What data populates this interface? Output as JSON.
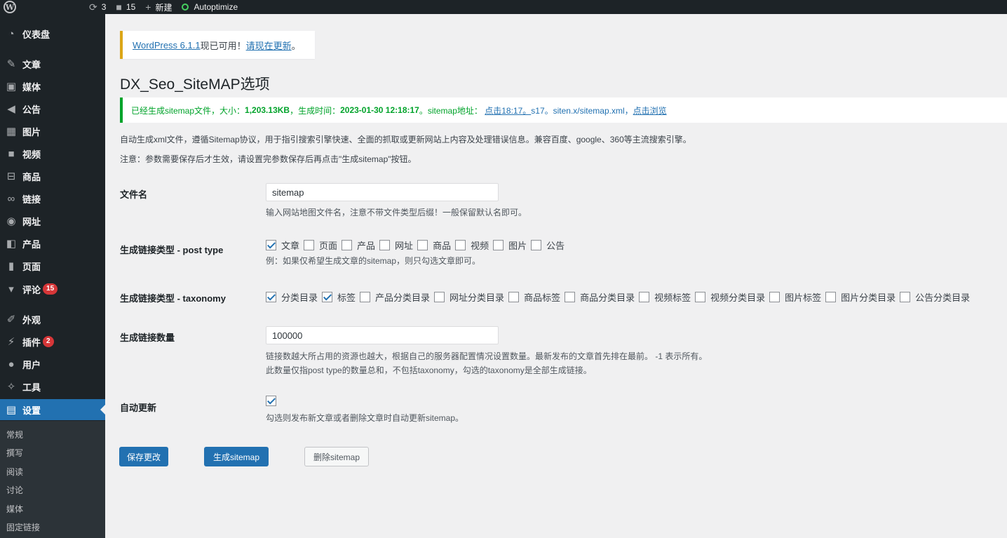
{
  "adminbar": {
    "logo": "W",
    "updates_count": "3",
    "comments_count": "15",
    "new_label": "新建",
    "plugin_label": "Autoptimize"
  },
  "sidebar": {
    "items": [
      {
        "icon": "dashboard-icon",
        "label": "仪表盘"
      },
      {
        "icon": "pin-icon",
        "label": "文章"
      },
      {
        "icon": "media-icon",
        "label": "媒体"
      },
      {
        "icon": "megaphone-icon",
        "label": "公告"
      },
      {
        "icon": "image-icon",
        "label": "图片"
      },
      {
        "icon": "video-icon",
        "label": "视频"
      },
      {
        "icon": "cart-icon",
        "label": "商品"
      },
      {
        "icon": "link-icon",
        "label": "链接"
      },
      {
        "icon": "globe-icon",
        "label": "网址"
      },
      {
        "icon": "product-icon",
        "label": "产品"
      },
      {
        "icon": "page-icon",
        "label": "页面"
      },
      {
        "icon": "comment-icon",
        "label": "评论",
        "badge": "15"
      },
      {
        "icon": "brush-icon",
        "label": "外观"
      },
      {
        "icon": "plugin-icon",
        "label": "插件",
        "badge": "2"
      },
      {
        "icon": "user-icon",
        "label": "用户"
      },
      {
        "icon": "wrench-icon",
        "label": "工具"
      },
      {
        "icon": "settings-icon",
        "label": "设置"
      }
    ],
    "submenu": [
      "常规",
      "撰写",
      "阅读",
      "讨论",
      "媒体",
      "固定链接"
    ]
  },
  "notice_update": {
    "link1": "WordPress 6.1.1",
    "text": "现已可用！",
    "link2": "请现在更新",
    "end": "。"
  },
  "page_title": "DX_Seo_SiteMAP选项",
  "notice_success": {
    "prefix": "已经生成sitemap文件，大小：",
    "size": "1,203.13KB",
    "time_label": "，生成时间：",
    "time": "2023-01-30 12:18:17",
    "addr_label": "。sitemap地址：",
    "link_click": "点击18:17。",
    "link_url": "s17。siten.x/sitemap.xml",
    "sep": "，",
    "link_browse": "点击浏览"
  },
  "description": [
    "自动生成xml文件，遵循Sitemap协议，用于指引搜索引擎快速、全面的抓取或更新网站上内容及处理错误信息。兼容百度、google、360等主流搜索引擎。",
    "注意：参数需要保存后才生效，请设置完参数保存后再点击\"生成sitemap\"按钮。"
  ],
  "fields": {
    "filename": {
      "label": "文件名",
      "value": "sitemap",
      "help": "输入网站地图文件名，注意不带文件类型后缀！一般保留默认名即可。"
    },
    "post_type": {
      "label": "生成链接类型 - post type",
      "options": [
        {
          "label": "文章",
          "checked": true
        },
        {
          "label": "页面",
          "checked": false
        },
        {
          "label": "产品",
          "checked": false
        },
        {
          "label": "网址",
          "checked": false
        },
        {
          "label": "商品",
          "checked": false
        },
        {
          "label": "视频",
          "checked": false
        },
        {
          "label": "图片",
          "checked": false
        },
        {
          "label": "公告",
          "checked": false
        }
      ],
      "help": "例：如果仅希望生成文章的sitemap，则只勾选文章即可。"
    },
    "taxonomy": {
      "label": "生成链接类型 - taxonomy",
      "options": [
        {
          "label": "分类目录",
          "checked": true
        },
        {
          "label": "标签",
          "checked": true
        },
        {
          "label": "产品分类目录",
          "checked": false
        },
        {
          "label": "网址分类目录",
          "checked": false
        },
        {
          "label": "商品标签",
          "checked": false
        },
        {
          "label": "商品分类目录",
          "checked": false
        },
        {
          "label": "视频标签",
          "checked": false
        },
        {
          "label": "视频分类目录",
          "checked": false
        },
        {
          "label": "图片标签",
          "checked": false
        },
        {
          "label": "图片分类目录",
          "checked": false
        },
        {
          "label": "公告分类目录",
          "checked": false
        }
      ]
    },
    "count": {
      "label": "生成链接数量",
      "value": "100000",
      "help1": "链接数越大所占用的资源也越大，根据自己的服务器配置情况设置数量。最新发布的文章首先排在最前。 -1 表示所有。",
      "help2": "此数量仅指post type的数量总和，不包括taxonomy，勾选的taxonomy是全部生成链接。"
    },
    "auto_update": {
      "label": "自动更新",
      "checked": true,
      "help": "勾选则发布新文章或者删除文章时自动更新sitemap。"
    }
  },
  "buttons": {
    "save": "保存更改",
    "generate": "生成sitemap",
    "delete": "删除sitemap"
  }
}
